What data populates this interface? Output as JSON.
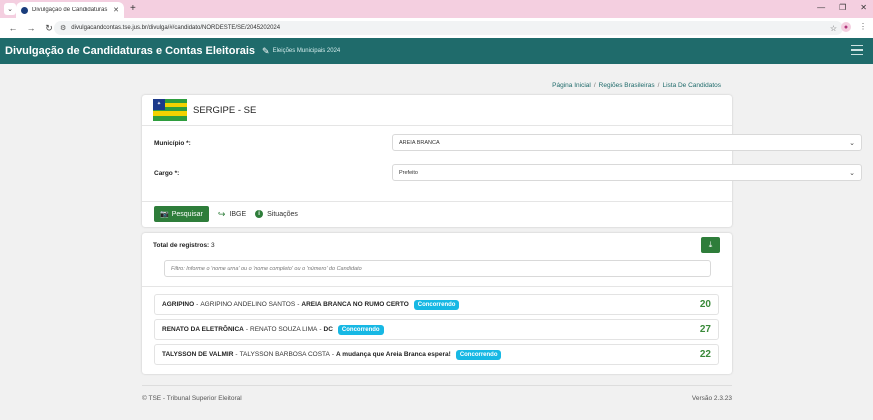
{
  "browser": {
    "tab_title": "Divulgação de Candidaturas e C",
    "url": "divulgacandcontas.tse.jus.br/divulga/#/candidato/NORDESTE/SE/2045202024"
  },
  "header": {
    "title": "Divulgação de Candidaturas e Contas Eleitorais",
    "subtitle": "Eleições Municipais 2024"
  },
  "breadcrumb": [
    "Página Inicial",
    "Regiões Brasileiras",
    "Lista De Candidatos"
  ],
  "state": {
    "name": "SERGIPE - SE"
  },
  "form": {
    "municipio_label": "Município *:",
    "municipio_value": "AREIA BRANCA",
    "cargo_label": "Cargo *:",
    "cargo_value": "Prefeito"
  },
  "toolbar": {
    "search_label": "Pesquisar",
    "ibge_label": "IBGE",
    "situacoes_label": "Situações"
  },
  "results": {
    "total_label": "Total de registros:",
    "total_value": "3",
    "filter_placeholder": "Filtro: Informe o 'nome urna' ou o 'nome completo' ou o 'número' do Candidato"
  },
  "candidates": [
    {
      "urna": "AGRIPINO",
      "full": "AGRIPINO ANDELINO SANTOS",
      "coalition": "AREIA BRANCA NO RUMO CERTO",
      "status": "Concorrendo",
      "number": "20"
    },
    {
      "urna": "RENATO DA ELETRÔNICA",
      "full": "RENATO SOUZA LIMA",
      "coalition": "DC",
      "status": "Concorrendo",
      "number": "27"
    },
    {
      "urna": "TALYSSON DE VALMIR",
      "full": "TALYSSON BARBOSA COSTA",
      "coalition": "A mudança que Areia Branca espera!",
      "status": "Concorrendo",
      "number": "22"
    }
  ],
  "footer": {
    "left": "© TSE - Tribunal Superior Eleitoral",
    "version": "Versão 2.3.23"
  },
  "colors": {
    "header_bg": "#1f6b6b",
    "button_green": "#2e7d3a",
    "badge_blue": "#17b8e4",
    "number_green": "#3a8a3a"
  }
}
